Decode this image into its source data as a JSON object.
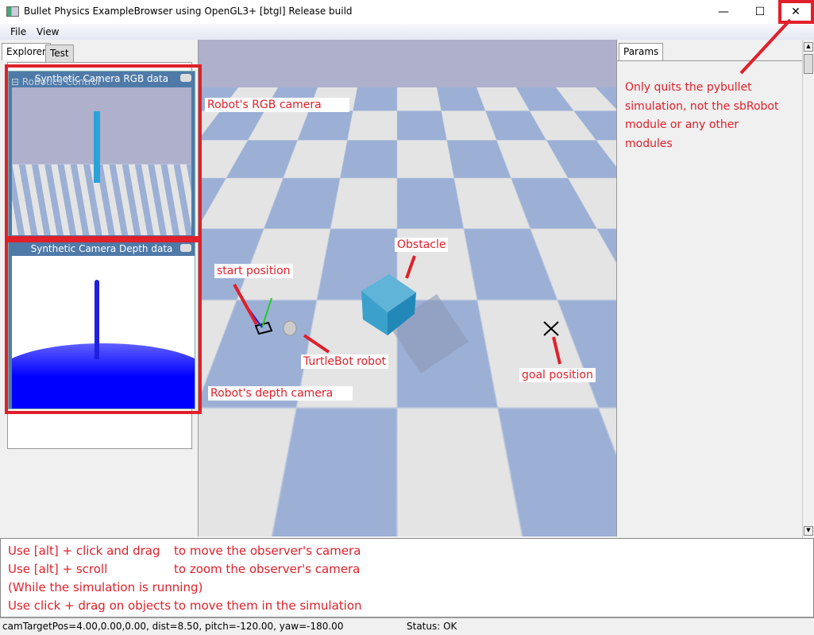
{
  "window": {
    "title": "Bullet Physics ExampleBrowser using OpenGL3+ [btgl] Release build",
    "minimize": "—",
    "maximize": "☐",
    "close": "✕"
  },
  "menu": {
    "file": "File",
    "view": "View"
  },
  "left_panel": {
    "tabs": [
      "Explorer",
      "Test"
    ],
    "tree_item": "⊟ Robotics Control",
    "rgb_window_title": "Synthetic Camera RGB data",
    "depth_window_title": "Synthetic Camera Depth data"
  },
  "right_panel": {
    "tab": "Params"
  },
  "annotations": {
    "quit": "Only quits the pybullet simulation, not the sbRobot module or any other modules",
    "rgb_camera": "Robot's RGB camera",
    "depth_camera": "Robot's depth camera",
    "start": "start position",
    "obstacle": "Obstacle",
    "turtlebot": "TurtleBot robot",
    "goal": "goal position"
  },
  "help": [
    {
      "action": "Use [alt] + click and drag",
      "effect": "to move the observer's camera"
    },
    {
      "action": "Use [alt] + scroll",
      "effect": "to zoom the observer's camera"
    },
    {
      "action": "(While the simulation is running)",
      "effect": ""
    },
    {
      "action": "Use click + drag on objects",
      "effect": "to move them in the simulation"
    }
  ],
  "status": {
    "camera": "camTargetPos=4.00,0.00,0.00, dist=8.50, pitch=-120.00, yaw=-180.00",
    "status": "Status: OK"
  },
  "colors": {
    "annotation": "#e0202a",
    "floor_blue": "#9cb0d6",
    "floor_light": "#e4e4e4",
    "sky": "#aeb0cc"
  }
}
